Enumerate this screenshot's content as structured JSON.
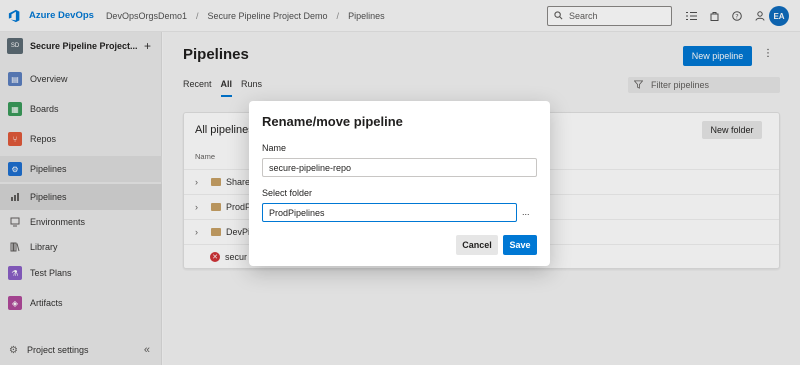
{
  "topbar": {
    "brand": "Azure DevOps",
    "breadcrumbs": [
      "DevOpsOrgsDemo1",
      "Secure Pipeline Project Demo",
      "Pipelines"
    ],
    "search_placeholder": "Search",
    "user_initials": "EA"
  },
  "sidebar": {
    "project_initials": "SD",
    "project_name": "Secure Pipeline Project...",
    "items": [
      {
        "label": "Overview",
        "icon": "overview-icon",
        "color": "#5c7fbf"
      },
      {
        "label": "Boards",
        "icon": "boards-icon",
        "color": "#3a9b5b"
      },
      {
        "label": "Repos",
        "icon": "repos-icon",
        "color": "#e05a3a"
      },
      {
        "label": "Pipelines",
        "icon": "pipelines-icon",
        "color": "#1e6fd0"
      },
      {
        "label": "Pipelines",
        "icon": "pipelines-sub-icon"
      },
      {
        "label": "Environments",
        "icon": "environments-icon"
      },
      {
        "label": "Library",
        "icon": "library-icon"
      },
      {
        "label": "Test Plans",
        "icon": "test-plans-icon",
        "color": "#8a5fc6"
      },
      {
        "label": "Artifacts",
        "icon": "artifacts-icon",
        "color": "#b0499b"
      }
    ],
    "settings_label": "Project settings"
  },
  "main": {
    "title": "Pipelines",
    "new_pipeline_label": "New pipeline",
    "tabs": [
      "Recent",
      "All",
      "Runs"
    ],
    "selected_tab": "All",
    "filter_placeholder": "Filter pipelines",
    "card": {
      "title": "All pipelines",
      "new_folder_label": "New folder",
      "column_name": "Name",
      "rows": [
        {
          "label": "Shared",
          "type": "folder"
        },
        {
          "label": "ProdP",
          "type": "folder"
        },
        {
          "label": "DevPip",
          "type": "folder"
        },
        {
          "label": "secur",
          "type": "pipeline-failed"
        }
      ]
    }
  },
  "modal": {
    "title": "Rename/move pipeline",
    "name_label": "Name",
    "name_value": "secure-pipeline-repo",
    "folder_label": "Select folder",
    "folder_value": "ProdPipelines",
    "browse_label": "...",
    "cancel_label": "Cancel",
    "save_label": "Save"
  }
}
